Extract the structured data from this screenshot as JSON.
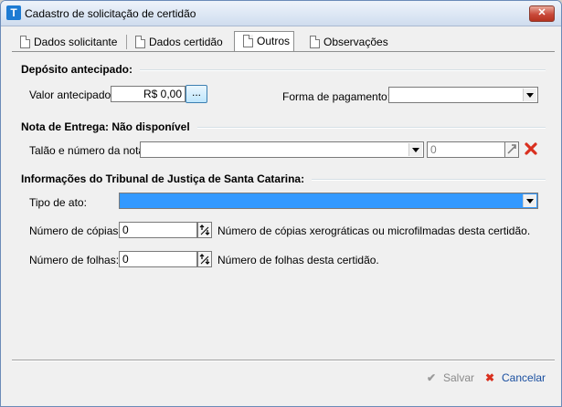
{
  "window": {
    "title": "Cadastro de solicitação de certidão",
    "app_icon": "T",
    "close_glyph": "✕"
  },
  "tabs": [
    {
      "label": "Dados solicitante",
      "active": false
    },
    {
      "label": "Dados certidão",
      "active": false
    },
    {
      "label": "Outros",
      "active": true
    },
    {
      "label": "Observações",
      "active": false
    }
  ],
  "deposito": {
    "title": "Depósito antecipado:",
    "valor_label": "Valor antecipado:",
    "valor_value": "R$ 0,00",
    "ellipsis_button": "...",
    "forma_label": "Forma de pagamento:",
    "forma_value": ""
  },
  "nota": {
    "title": "Nota de Entrega: Não disponível",
    "talao_label": "Talão e número da nota:",
    "talao_value": "",
    "numero_value": "0"
  },
  "tribunal": {
    "title": "Informações do Tribunal de Justiça de Santa Catarina:",
    "tipo_label": "Tipo de ato:",
    "tipo_value": "",
    "copias_label": "Número de cópias:",
    "copias_value": "0",
    "copias_desc": "Número de cópias xerográticas ou microfilmadas desta certidão.",
    "folhas_label": "Número de folhas:",
    "folhas_value": "0",
    "folhas_desc": "Número de folhas desta certidão."
  },
  "actions": {
    "salvar": "Salvar",
    "cancelar": "Cancelar",
    "salvar_icon": "✔",
    "cancelar_icon": "✖"
  },
  "colors": {
    "accent": "#3399ff",
    "delete_red": "#d9301f",
    "save_disabled": "#8a8a8a"
  }
}
